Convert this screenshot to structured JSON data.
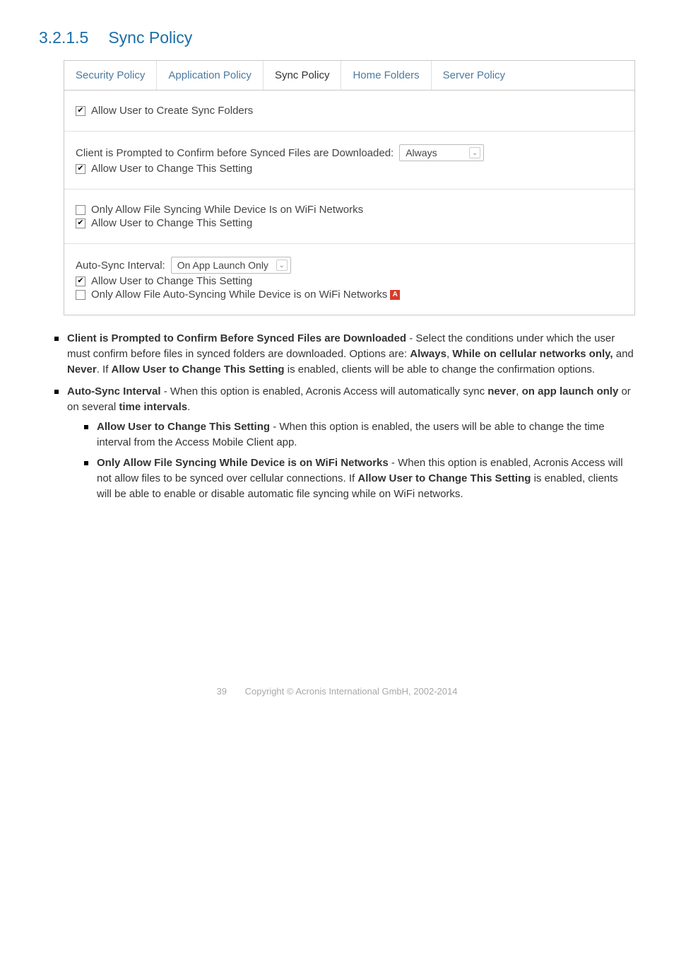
{
  "heading": {
    "number": "3.2.1.5",
    "title": "Sync Policy"
  },
  "tabs": [
    "Security Policy",
    "Application Policy",
    "Sync Policy",
    "Home Folders",
    "Server Policy"
  ],
  "panel": {
    "s1": {
      "chk1": "Allow User to Create Sync Folders"
    },
    "s2": {
      "label": "Client is Prompted to Confirm before Synced Files are Downloaded:",
      "select": "Always",
      "chk": "Allow User to Change This Setting"
    },
    "s3": {
      "chk1": "Only Allow File Syncing While Device Is on WiFi Networks",
      "chk2": "Allow User to Change This Setting"
    },
    "s4": {
      "label": "Auto-Sync Interval:",
      "select": "On App Launch Only",
      "chk1": "Allow User to Change This Setting",
      "chk2": "Only Allow File Auto-Syncing While Device is on WiFi Networks"
    }
  },
  "desc": {
    "b1": {
      "t1": "Client is Prompted to Confirm Before Synced Files are Downloaded",
      "t2": " - Select the conditions under which the user must confirm before files in synced folders are downloaded. Options are: ",
      "t3": "Always",
      "t4": ", ",
      "t5": "While on cellular networks only,",
      "t6": " and ",
      "t7": "Never",
      "t8": ". If ",
      "t9": "Allow User to Change This Setting",
      "t10": " is enabled, clients will be able to change the confirmation options."
    },
    "b2": {
      "t1": "Auto-Sync Interval",
      "t2": " - When this option is enabled, Acronis Access will automatically sync ",
      "t3": "never",
      "t4": ", ",
      "t5": "on app launch only",
      "t6": " or on several ",
      "t7": "time intervals",
      "t8": "."
    },
    "b21": {
      "t1": "Allow User to Change This Setting",
      "t2": " - When this option is enabled, the users will be able to change the time interval from the Access Mobile Client app."
    },
    "b22": {
      "t1": "Only Allow File Syncing While Device is on WiFi Networks",
      "t2": " - When this option is enabled, Acronis Access will not allow files to be synced over cellular connections.    If ",
      "t3": "Allow User to Change This Setting",
      "t4": " is enabled, clients will be able to enable or disable automatic file syncing while on WiFi networks."
    }
  },
  "footer": {
    "page": "39",
    "copyright": "Copyright © Acronis International GmbH, 2002-2014"
  }
}
